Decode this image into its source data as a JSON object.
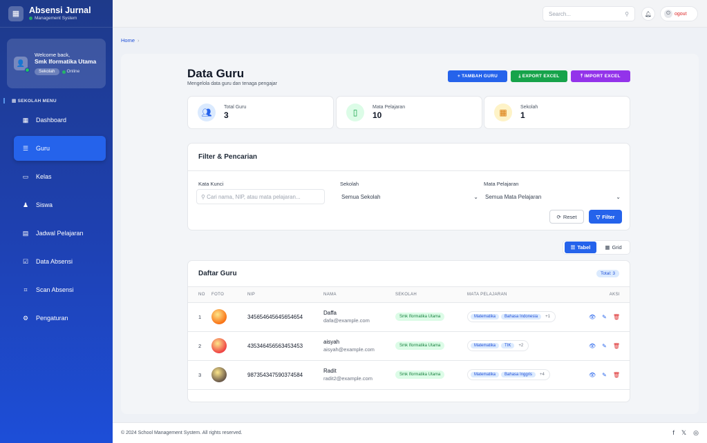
{
  "brand": {
    "title": "Absensi Jurnal",
    "subtitle": "Management System",
    "logo_icon": "building-icon"
  },
  "welcome": {
    "greeting": "Welcome back,",
    "name": "Smk Iformatika Utama",
    "badge": "Sekolah",
    "status": "Online"
  },
  "sidebar": {
    "menu_title": "SEKOLAH MENU",
    "items": [
      {
        "label": "Dashboard",
        "icon": "▦",
        "active": false
      },
      {
        "label": "Guru",
        "icon": "☰",
        "active": true
      },
      {
        "label": "Kelas",
        "icon": "▭",
        "active": false
      },
      {
        "label": "Siswa",
        "icon": "♟",
        "active": false
      },
      {
        "label": "Jadwal Pelajaran",
        "icon": "▤",
        "active": false
      },
      {
        "label": "Data Absensi",
        "icon": "☑",
        "active": false
      },
      {
        "label": "Scan Absensi",
        "icon": "⌗",
        "active": false
      },
      {
        "label": "Pengaturan",
        "icon": "⚙",
        "active": false
      }
    ]
  },
  "topbar": {
    "search_placeholder": "Search...",
    "logout_label": "ogout"
  },
  "breadcrumb": {
    "home": "Home",
    "sep": "›"
  },
  "page": {
    "title": "Data Guru",
    "subtitle": "Mengelola data guru dan tenaga pengajar",
    "btn_add": "+ TAMBAH GURU",
    "btn_export": "⤓ EXPORT EXCEL",
    "btn_import": "⤒ IMPORT EXCEL"
  },
  "stats": [
    {
      "label": "Total Guru",
      "value": "3",
      "icon": "👥",
      "bg": "#dbeafe",
      "color": "#2563eb"
    },
    {
      "label": "Mata Pelajaran",
      "value": "10",
      "icon": "📋",
      "bg": "#dcfce7",
      "color": "#16a34a"
    },
    {
      "label": "Sekolah",
      "value": "1",
      "icon": "🏢",
      "bg": "#fef3c7",
      "color": "#d97706"
    }
  ],
  "filter": {
    "title": "Filter & Pencarian",
    "keyword_label": "Kata Kunci",
    "keyword_placeholder": "Cari nama, NIP, atau mata pelajaran...",
    "school_label": "Sekolah",
    "school_value": "Semua Sekolah",
    "subject_label": "Mata Pelajaran",
    "subject_value": "Semua Mata Pelajaran",
    "reset_label": "Reset",
    "filter_label": "Filter"
  },
  "view": {
    "tabel": "Tabel",
    "grid": "Grid"
  },
  "table": {
    "title": "Daftar Guru",
    "total": "Total: 3",
    "headers": [
      "NO",
      "FOTO",
      "NIP",
      "NAMA",
      "SEKOLAH",
      "MATA PELAJARAN",
      "AKSI"
    ],
    "rows": [
      {
        "no": "1",
        "nip": "345654645645654654",
        "name": "Daffa",
        "email": "dafa@example.com",
        "school": "Smk Iformatika Utama",
        "subjects": [
          "Matematika",
          "Bahasa Indonesia"
        ],
        "more": "+1",
        "photo_color": "#f97316"
      },
      {
        "no": "2",
        "nip": "435346456563453453",
        "name": "aisyah",
        "email": "aisyah@example.com",
        "school": "Smk Iformatika Utama",
        "subjects": [
          "Matematika",
          "TIK"
        ],
        "more": "+2",
        "photo_color": "#ef4444"
      },
      {
        "no": "3",
        "nip": "987354347590374584",
        "name": "Radit",
        "email": "radit2@example.com",
        "school": "Smk Iformatika Utama",
        "subjects": [
          "Matematika",
          "Bahasa Inggris"
        ],
        "more": "+4",
        "photo_color": "#6b5a4a"
      }
    ]
  },
  "footer": {
    "copyright": "© 2024 School Management System. All rights reserved.",
    "social": [
      "f",
      "𝕏",
      "◎"
    ]
  }
}
